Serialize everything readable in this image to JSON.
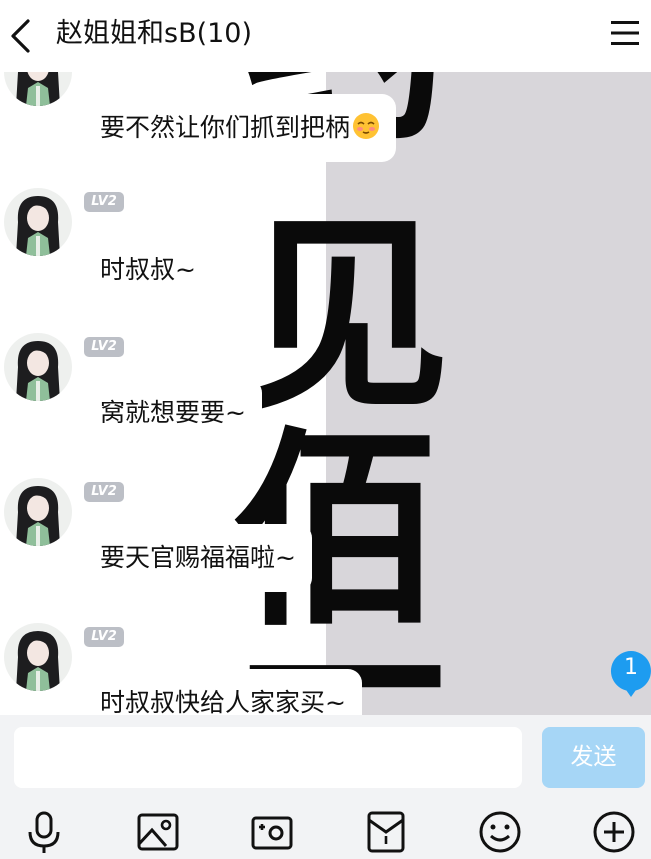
{
  "header": {
    "title": "赵姐姐和sB(10)",
    "back_icon": "chevron-left-icon",
    "menu_icon": "hamburger-menu-icon"
  },
  "background": {
    "glyphs": [
      "约",
      "见",
      "佰",
      "万"
    ]
  },
  "messages": [
    {
      "text": "要不然让你们抓到把柄",
      "emoji": "blush-face-emoji"
    },
    {
      "level": "LV2",
      "text": "时叔叔~"
    },
    {
      "level": "LV2",
      "text": "窝就想要要~"
    },
    {
      "level": "LV2",
      "text": "要天官赐福福啦~"
    },
    {
      "level": "LV2",
      "text": "时叔叔快给人家家买~"
    }
  ],
  "unread_count": "1",
  "input": {
    "value": "",
    "send_label": "发送"
  },
  "toolbar": {
    "items": [
      "microphone-icon",
      "image-icon",
      "camera-icon",
      "red-packet-icon",
      "emoji-icon",
      "plus-icon"
    ]
  },
  "colors": {
    "send_button": "#a6d6f6",
    "unread_badge": "#1d9cf0",
    "level_badge": "#bcbfc6",
    "input_bar": "#f2f3f5"
  }
}
